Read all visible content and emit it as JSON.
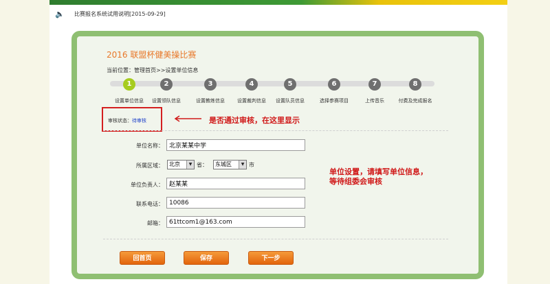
{
  "notice": {
    "icon": "speaker-icon",
    "text": "比赛报名系统试用说明[2015-09-29]"
  },
  "competition_title": "2016 联盟杯健美操比赛",
  "breadcrumb": "当前位置：管理首页>>设置单位信息",
  "steps": [
    {
      "num": "1",
      "label": "设置单位信息",
      "active": true
    },
    {
      "num": "2",
      "label": "设置领队信息",
      "active": false
    },
    {
      "num": "3",
      "label": "设置教练信息",
      "active": false
    },
    {
      "num": "4",
      "label": "设置裁判信息",
      "active": false
    },
    {
      "num": "5",
      "label": "设置队员信息",
      "active": false
    },
    {
      "num": "6",
      "label": "选择参赛项目",
      "active": false
    },
    {
      "num": "7",
      "label": "上传音乐",
      "active": false
    },
    {
      "num": "8",
      "label": "付费及完成报名",
      "active": false
    }
  ],
  "status": {
    "label": "审核状态：",
    "value": "待审核"
  },
  "annotation_status": "是否通过审核，在这里显示",
  "annotation_form": [
    "单位设置，请填写单位信息，",
    "等待组委会审核"
  ],
  "form": {
    "unit_name_label": "单位名称：",
    "unit_name_value": "北京某某中学",
    "region_label": "所属区域：",
    "province_value": "北京",
    "province_suffix": "省：",
    "city_value": "东城区",
    "city_suffix": "市",
    "leader_label": "单位负责人：",
    "leader_value": "赵某某",
    "phone_label": "联系电话：",
    "phone_value": "10086",
    "email_label": "邮箱：",
    "email_value": "61ttcom1@163.com"
  },
  "buttons": {
    "home": "回首页",
    "save": "保存",
    "next": "下一步"
  },
  "colors": {
    "accent_orange": "#e8782a",
    "panel_border": "#8fbf72",
    "annotation_red": "#d01818",
    "active_step": "#a6cc1f"
  }
}
